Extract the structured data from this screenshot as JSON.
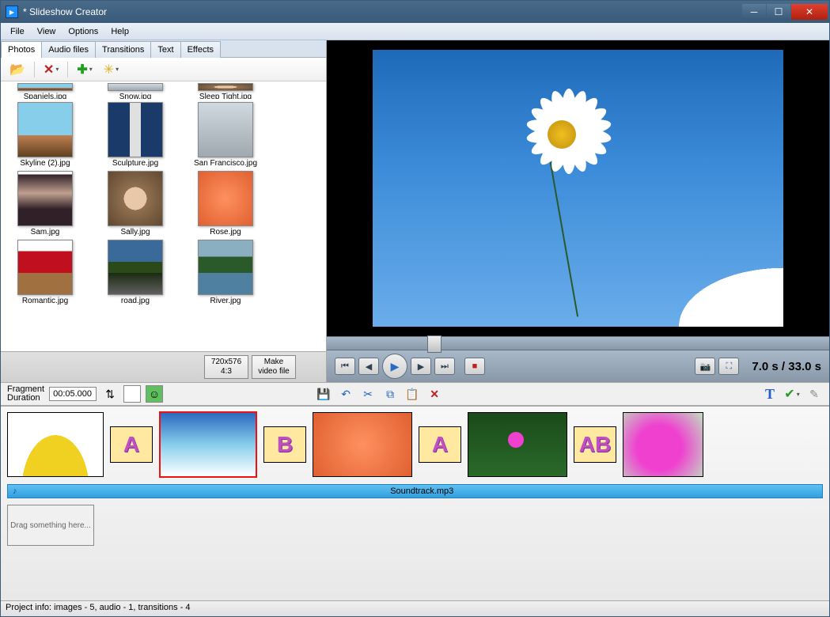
{
  "title": "*  Slideshow Creator",
  "menu": {
    "file": "File",
    "view": "View",
    "options": "Options",
    "help": "Help"
  },
  "tabs": {
    "photos": "Photos",
    "audio": "Audio files",
    "transitions": "Transitions",
    "text": "Text",
    "effects": "Effects"
  },
  "thumbnails": [
    {
      "name": "Spaniels.jpg",
      "cls": "sky",
      "partial": true
    },
    {
      "name": "Snow.jpg",
      "cls": "city",
      "partial": true
    },
    {
      "name": "Sleep Tight.jpg",
      "cls": "sally",
      "partial": true
    },
    {
      "name": "Skyline (2).jpg",
      "cls": "sky"
    },
    {
      "name": "Sculpture.jpg",
      "cls": "sculpture"
    },
    {
      "name": "San Francisco.jpg",
      "cls": "city"
    },
    {
      "name": "Sam.jpg",
      "cls": "sam"
    },
    {
      "name": "Sally.jpg",
      "cls": "sally"
    },
    {
      "name": "Rose.jpg",
      "cls": "rose"
    },
    {
      "name": "Romantic.jpg",
      "cls": "romantic"
    },
    {
      "name": "road.jpg",
      "cls": "road"
    },
    {
      "name": "River.jpg",
      "cls": "river"
    }
  ],
  "buttons": {
    "resolution": "720x576\n4:3",
    "makevideo": "Make\nvideo file"
  },
  "playback": {
    "current": "7.0 s",
    "sep": " / ",
    "total": "33.0 s"
  },
  "duration": {
    "label": "Fragment\nDuration",
    "value": "00:05.000"
  },
  "timeline": {
    "audio": "Soundtrack.mp3",
    "drop_hint": "Drag something here...",
    "trans": [
      "A",
      "B",
      "A",
      "AB"
    ]
  },
  "status": "Project info: images - 5, audio - 1, transitions - 4"
}
